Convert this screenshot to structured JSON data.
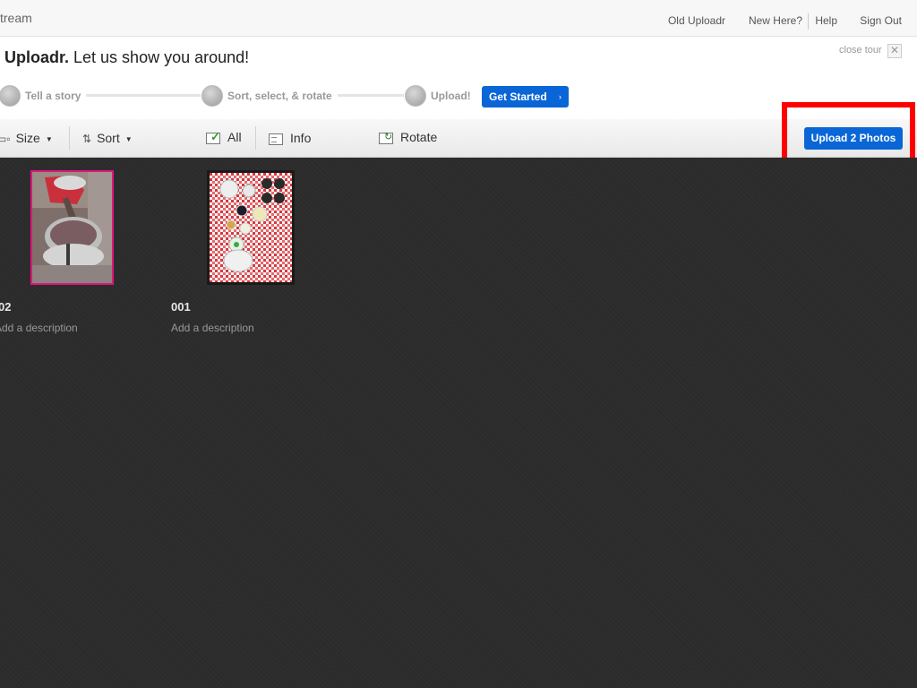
{
  "header": {
    "brand_fragment": "tream",
    "nav": [
      "Old Uploadr",
      "New Here?",
      "Help",
      "Sign Out"
    ]
  },
  "tour": {
    "title_prefix": "r ",
    "title_brand": "Uploadr.",
    "title_rest": " Let us show you around!",
    "close_label": "close tour",
    "close_icon": "✕",
    "steps": [
      "Tell a story",
      "Sort, select, & rotate",
      "Upload!"
    ],
    "cta_label": "Get Started",
    "cta_icon": "›"
  },
  "toolbar": {
    "size_label": "Size",
    "sort_label": "Sort",
    "all_label": "All",
    "info_label": "Info",
    "rotate_label": "Rotate",
    "upload_label": "Upload 2 Photos"
  },
  "photos": [
    {
      "title": "02",
      "description": "Add a description",
      "selected": true
    },
    {
      "title": "001",
      "description": "Add a description",
      "selected": false
    }
  ],
  "colors": {
    "accent": "#0a66d6",
    "selection": "#e0157a",
    "highlight": "#ff0000",
    "canvas": "#2b2b2b"
  }
}
